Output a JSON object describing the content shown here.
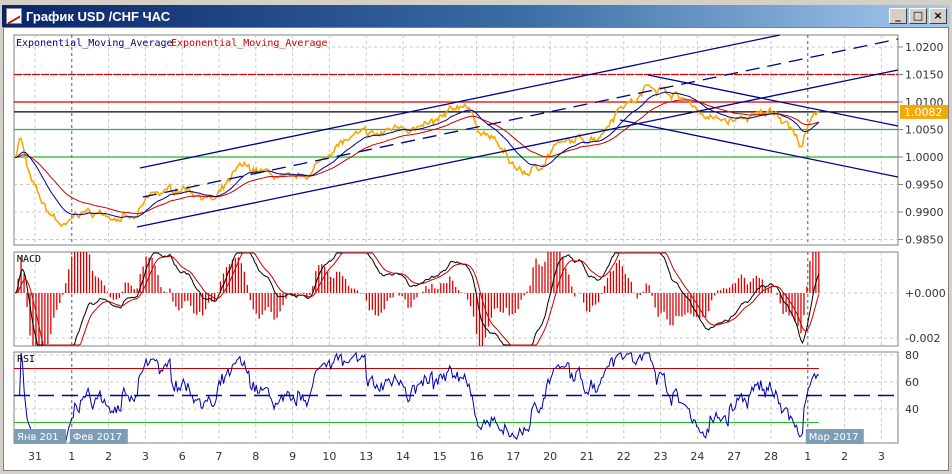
{
  "window": {
    "title": "График USD /CHF  ЧАС",
    "minimize": "_",
    "maximize": "□",
    "close": "×"
  },
  "legend": {
    "ema_fast": "Exponential_Moving_Average",
    "ema_slow": "Exponential_Moving_Average"
  },
  "colors": {
    "price": "#f5a800",
    "ema_fast": "#00008b",
    "ema_slow": "#cc0000",
    "channel": "#00008b",
    "support": "#22bb22",
    "resistance": "#dd0000",
    "current": "#000000",
    "date_tag": "#7f9cb5"
  },
  "chart_data": {
    "type": "line",
    "title": "USD /CHF",
    "price_axis": {
      "ticks": [
        "1.0200",
        "1.0150",
        "1.0100",
        "1.0050",
        "1.0000",
        "0.9950",
        "0.9900",
        "0.9850"
      ],
      "tick_values": [
        1.02,
        1.015,
        1.01,
        1.005,
        1.0,
        0.995,
        0.99,
        0.985
      ],
      "ylim": [
        0.9835,
        1.0222
      ]
    },
    "current_price": "1.0082",
    "current_price_value": 1.0082,
    "x_labels": [
      "31",
      "1",
      "2",
      "3",
      "6",
      "7",
      "8",
      "9",
      "10",
      "13",
      "14",
      "15",
      "16",
      "17",
      "20",
      "21",
      "22",
      "23",
      "24",
      "27",
      "28",
      "1",
      "2",
      "3"
    ],
    "month_tags": [
      {
        "label": "Янв 201",
        "at": 0
      },
      {
        "label": "Фев 2017",
        "at": 1
      },
      {
        "label": "Мар 2017",
        "at": 21
      }
    ],
    "price_series": {
      "name": "USD/CHF H1",
      "points": [
        [
          -0.54,
          1.0
        ],
        [
          -0.4,
          1.004
        ],
        [
          -0.14,
          0.996
        ],
        [
          0.27,
          0.9905
        ],
        [
          0.82,
          0.987
        ],
        [
          1.22,
          0.99
        ],
        [
          2.04,
          0.9895
        ],
        [
          2.72,
          0.9885
        ],
        [
          3.13,
          0.993
        ],
        [
          4.08,
          0.9945
        ],
        [
          4.89,
          0.992
        ],
        [
          5.57,
          0.998
        ],
        [
          6.11,
          0.9975
        ],
        [
          6.93,
          0.9955
        ],
        [
          7.47,
          0.997
        ],
        [
          8.15,
          1.002
        ],
        [
          8.83,
          1.004
        ],
        [
          9.38,
          1.004
        ],
        [
          9.92,
          1.006
        ],
        [
          10.46,
          1.005
        ],
        [
          11.0,
          1.0065
        ],
        [
          11.68,
          1.01
        ],
        [
          12.09,
          1.005
        ],
        [
          12.5,
          1.003
        ],
        [
          12.9,
          0.999
        ],
        [
          13.3,
          0.997
        ],
        [
          13.7,
          0.998
        ],
        [
          14.1,
          1.002
        ],
        [
          14.8,
          1.003
        ],
        [
          15.35,
          1.004
        ],
        [
          15.9,
          1.0095
        ],
        [
          16.4,
          1.0105
        ],
        [
          16.7,
          1.0135
        ],
        [
          17.3,
          1.0115
        ],
        [
          17.8,
          1.01
        ],
        [
          18.3,
          1.007
        ],
        [
          18.9,
          1.0065
        ],
        [
          19.7,
          1.0075
        ],
        [
          20.1,
          1.0085
        ],
        [
          20.5,
          1.006
        ],
        [
          20.8,
          1.002
        ],
        [
          21.06,
          1.006
        ],
        [
          21.3,
          1.0082
        ]
      ]
    },
    "horizontal_levels": [
      {
        "value": 1.015,
        "kind": "resistance",
        "dashed": true
      },
      {
        "value": 1.01,
        "kind": "resistance",
        "dashed": false
      },
      {
        "value": 1.0082,
        "kind": "current",
        "dashed": false
      },
      {
        "value": 1.005,
        "kind": "support",
        "dashed": false
      },
      {
        "value": 1.0,
        "kind": "support",
        "dashed": false
      }
    ],
    "trend_lines": [
      {
        "name": "asc-channel-top",
        "from": [
          2.85,
          0.998
        ],
        "to": [
          20.24,
          1.02218
        ],
        "dashed": false
      },
      {
        "name": "asc-channel-mid",
        "from": [
          2.93,
          0.99273
        ],
        "to": [
          23.45,
          1.02145
        ],
        "dashed": true
      },
      {
        "name": "asc-channel-bottom",
        "from": [
          2.77,
          0.98727
        ],
        "to": [
          23.45,
          1.01582
        ],
        "dashed": false
      },
      {
        "name": "desc-channel-top",
        "from": [
          16.66,
          1.01491
        ],
        "to": [
          23.45,
          1.00564
        ],
        "dashed": false
      },
      {
        "name": "desc-channel-bottom",
        "from": [
          15.9,
          1.00673
        ],
        "to": [
          23.45,
          0.99636
        ],
        "dashed": false
      }
    ],
    "macd": {
      "label": "MACD",
      "ticks": [
        "+0.000",
        "-0.002"
      ],
      "tick_values": [
        0,
        -0.002
      ]
    },
    "rsi": {
      "label": "RSI",
      "ticks": [
        "80",
        "60",
        "40"
      ],
      "tick_values": [
        80,
        60,
        40
      ],
      "levels": [
        70,
        50,
        30
      ]
    }
  }
}
